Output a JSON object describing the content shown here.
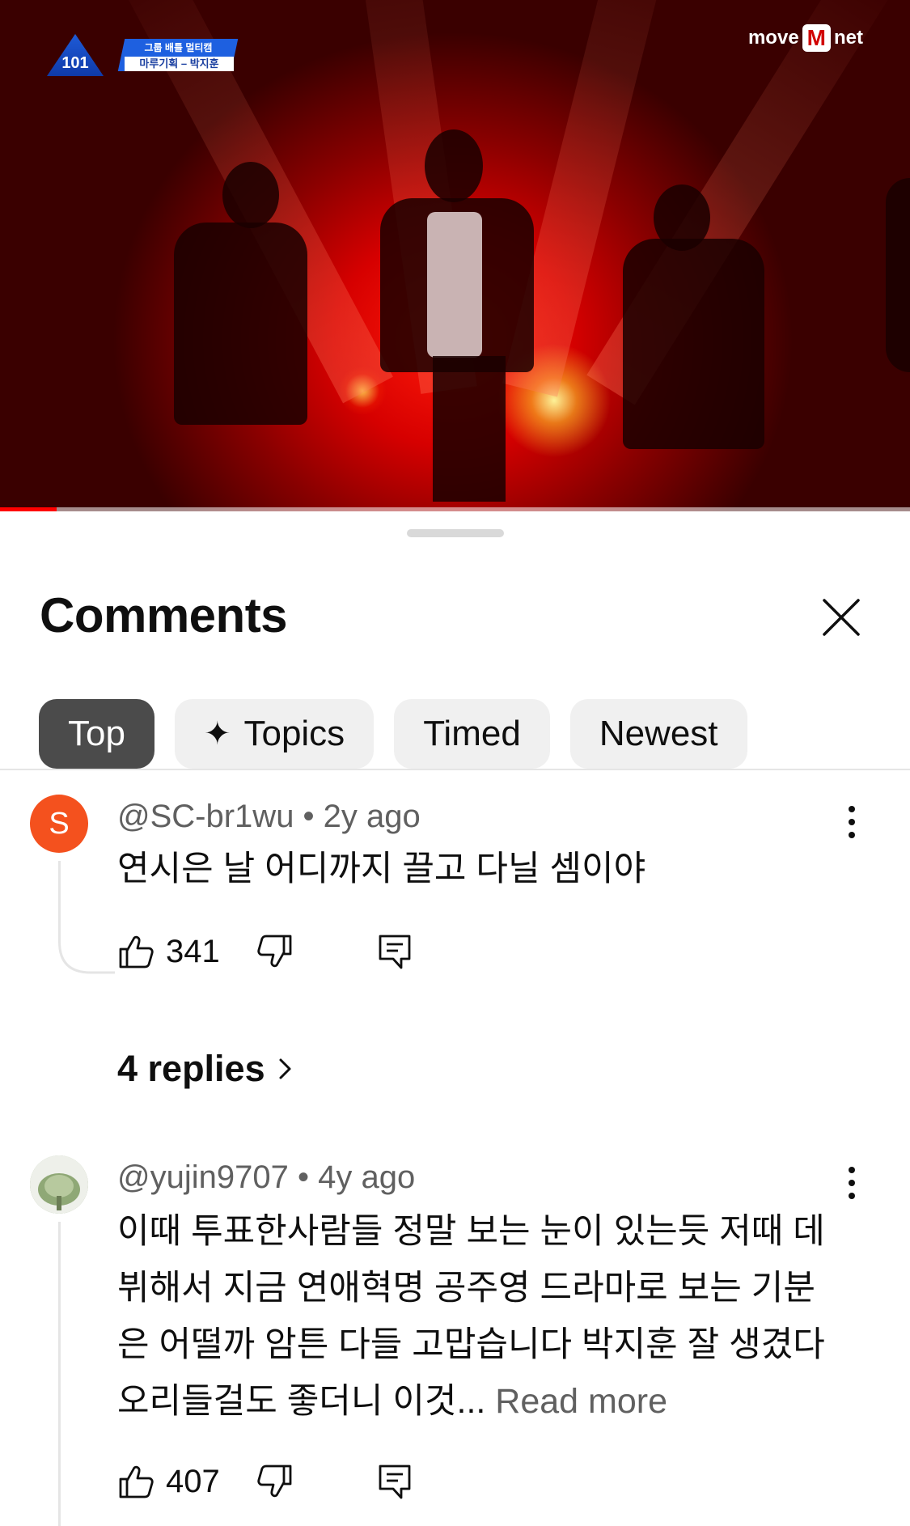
{
  "video": {
    "show_badge_line1": "그룹 배틀 멀티캠",
    "show_badge_line2": "마루기획 – 박지훈",
    "show_logo": "PRODUCE 101",
    "channel_logo": "move",
    "channel_logo_mnet": "M",
    "channel_logo_suffix": "net",
    "progress_fraction": 0.062,
    "progress_color": "#ff0000"
  },
  "sheet": {
    "title": "Comments",
    "close_icon": "close-icon",
    "chips": [
      {
        "label": "Top",
        "active": true
      },
      {
        "label": "Topics",
        "icon": "sparkle-icon",
        "icon_glyph": "✦"
      },
      {
        "label": "Timed"
      },
      {
        "label": "Newest"
      }
    ]
  },
  "comments": [
    {
      "avatar_letter": "S",
      "avatar_color": "#f4511e",
      "author": "@SC-br1wu",
      "separator": " • ",
      "age": "2y ago",
      "text": "연시은 날 어디까지 끌고 다닐 셈이야",
      "likes": "341",
      "replies_label": "4 replies"
    },
    {
      "avatar_icon": "user-photo-avatar",
      "author": "@yujin9707",
      "separator": " • ",
      "age": "4y ago",
      "text": "이때 투표한사람들 정말 보는 눈이 있는듯 저때 데뷔해서 지금 연애혁명 공주영 드라마로 보는 기분은 어떨까 암튼 다들 고맙습니다 박지훈 잘 생겼다 오리들걸도 좋더니 이것... ",
      "read_more": "Read more",
      "likes": "407"
    }
  ]
}
